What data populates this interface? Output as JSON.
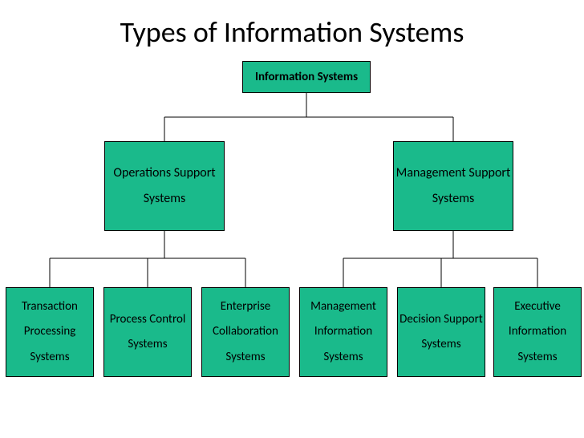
{
  "title": "Types of Information Systems",
  "root": "Information Systems",
  "mid": {
    "ops": "Operations Support Systems",
    "mgmt": "Management Support Systems"
  },
  "leaves": {
    "tps": "Transaction Processing Systems",
    "pcs": "Process Control Systems",
    "ecs": "Enterprise Collaboration Systems",
    "mis": "Management Information Systems",
    "dss": "Decision Support Systems",
    "eis": "Executive Information Systems"
  }
}
